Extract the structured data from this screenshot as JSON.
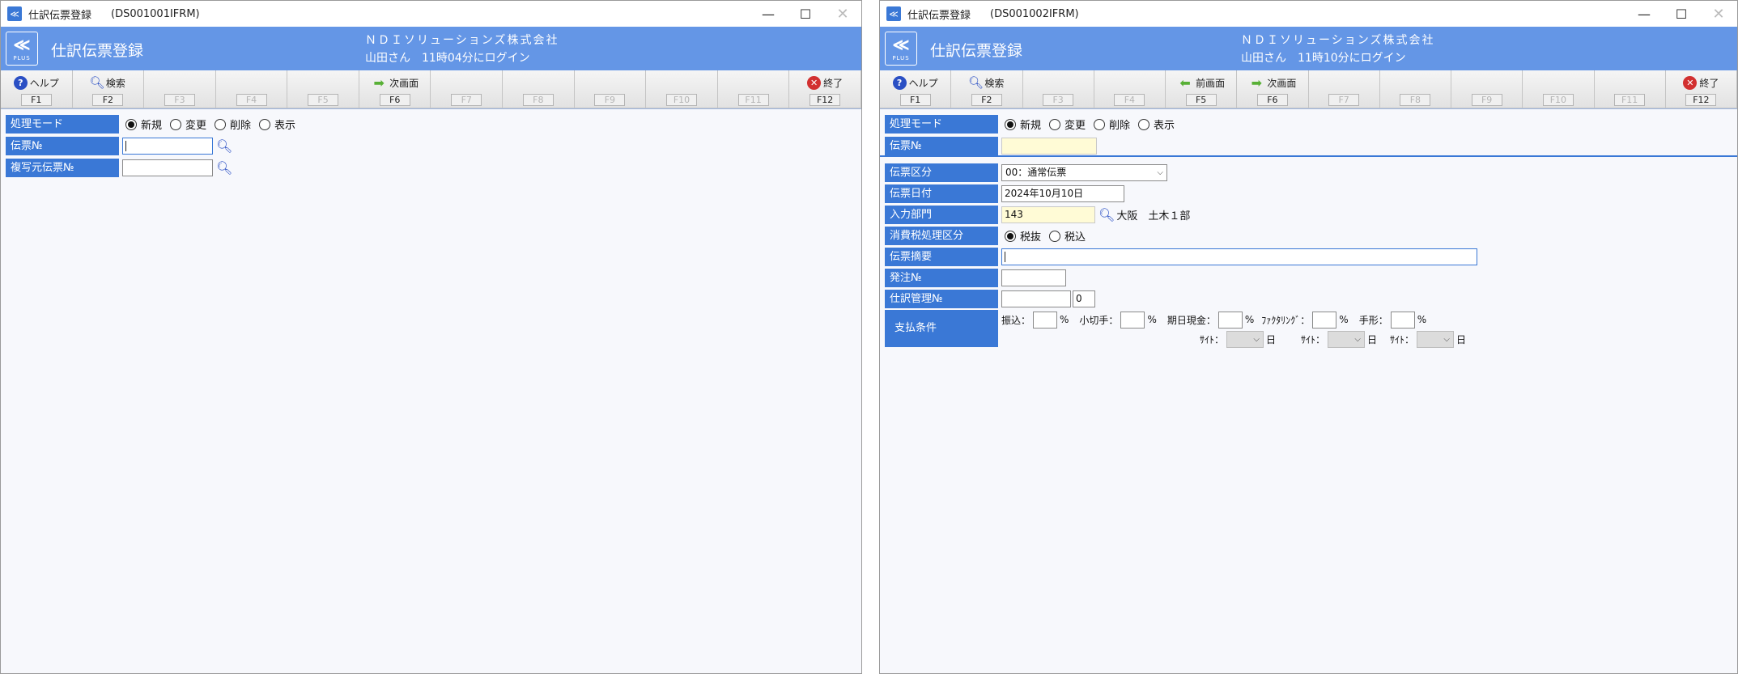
{
  "window1": {
    "title": "仕訳伝票登録",
    "code": "(DS001001IFRM)",
    "app_title": "仕訳伝票登録",
    "company": "ＮＤＩソリューションズ株式会社",
    "login": "山田さん　11時04分にログイン",
    "fkeys": [
      {
        "key": "F1",
        "label": "ヘルプ",
        "icon": "help-icon"
      },
      {
        "key": "F2",
        "label": "検索",
        "icon": "search-icon"
      },
      {
        "key": "F3",
        "label": ""
      },
      {
        "key": "F4",
        "label": ""
      },
      {
        "key": "F5",
        "label": ""
      },
      {
        "key": "F6",
        "label": "次画面",
        "icon": "next-arrow-icon"
      },
      {
        "key": "F7",
        "label": ""
      },
      {
        "key": "F8",
        "label": ""
      },
      {
        "key": "F9",
        "label": ""
      },
      {
        "key": "F10",
        "label": ""
      },
      {
        "key": "F11",
        "label": ""
      },
      {
        "key": "F12",
        "label": "終了",
        "icon": "exit-icon"
      }
    ],
    "form": {
      "mode_label": "処理モード",
      "modes": [
        "新規",
        "変更",
        "削除",
        "表示"
      ],
      "selected_mode": "新規",
      "voucher_no_label": "伝票№",
      "voucher_no_value": "",
      "copy_source_label": "複写元伝票№",
      "copy_source_value": ""
    }
  },
  "window2": {
    "title": "仕訳伝票登録",
    "code": "(DS001002IFRM)",
    "app_title": "仕訳伝票登録",
    "company": "ＮＤＩソリューションズ株式会社",
    "login": "山田さん　11時10分にログイン",
    "fkeys": [
      {
        "key": "F1",
        "label": "ヘルプ",
        "icon": "help-icon"
      },
      {
        "key": "F2",
        "label": "検索",
        "icon": "search-icon"
      },
      {
        "key": "F3",
        "label": ""
      },
      {
        "key": "F4",
        "label": ""
      },
      {
        "key": "F5",
        "label": "前画面",
        "icon": "prev-arrow-icon"
      },
      {
        "key": "F6",
        "label": "次画面",
        "icon": "next-arrow-icon"
      },
      {
        "key": "F7",
        "label": ""
      },
      {
        "key": "F8",
        "label": ""
      },
      {
        "key": "F9",
        "label": ""
      },
      {
        "key": "F10",
        "label": ""
      },
      {
        "key": "F11",
        "label": ""
      },
      {
        "key": "F12",
        "label": "終了",
        "icon": "exit-icon"
      }
    ],
    "form": {
      "mode_label": "処理モード",
      "modes": [
        "新規",
        "変更",
        "削除",
        "表示"
      ],
      "selected_mode": "新規",
      "voucher_no_label": "伝票№",
      "voucher_no_value": "",
      "voucher_type_label": "伝票区分",
      "voucher_type_value": "00：通常伝票",
      "voucher_date_label": "伝票日付",
      "voucher_date_value": "2024年10月10日",
      "dept_label": "入力部門",
      "dept_code": "143",
      "dept_name": "大阪　土木１部",
      "tax_label": "消費税処理区分",
      "tax_options": [
        "税抜",
        "税込"
      ],
      "tax_selected": "税抜",
      "summary_label": "伝票摘要",
      "summary_value": "",
      "order_no_label": "発注№",
      "order_no_value": "",
      "journal_mgmt_label": "仕訳管理№",
      "journal_mgmt_value": "",
      "journal_mgmt_sub": "0",
      "payment_label": "支払条件",
      "payment": {
        "transfer": "振込：",
        "check": "小切手：",
        "cash_on_due": "期日現金：",
        "factoring": "ﾌｧｸﾀﾘﾝｸﾞ：",
        "bill": "手形：",
        "percent": "%",
        "site": "ｻｲﾄ：",
        "day": "日"
      }
    }
  }
}
